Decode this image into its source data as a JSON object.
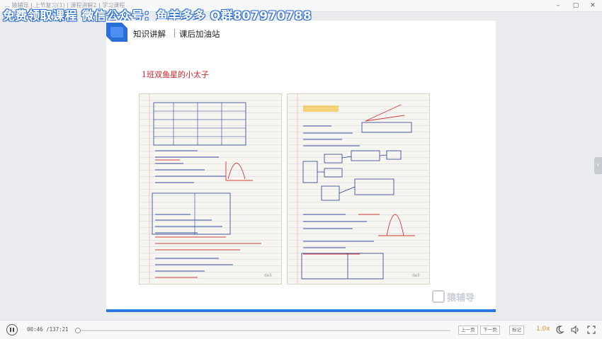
{
  "window": {
    "crumbs": "…  猿辅导  |  上节复习(1)  |  课程讲解2  |  学习课程"
  },
  "watermark": "免费领取课程 微信公众号：鱼羊多多 Q群807970788",
  "slide": {
    "tab_primary": "知识讲解",
    "tab_secondary": "课后加油站",
    "caption": "1班双鱼星的小太子",
    "photo1_brand": "deli",
    "photo2_brand": "deli",
    "brand_logo": "猿辅导"
  },
  "player": {
    "current_time": "00:46",
    "total_time": "/137:21",
    "progress": 0.006,
    "prev_label": "上一页",
    "next_label": "下一页",
    "mark_label": "标记",
    "speed": "1.0x"
  },
  "colors": {
    "accent_blue": "#2a78e4",
    "progress_orange": "#f08a24",
    "caption_red": "#d2242a"
  }
}
